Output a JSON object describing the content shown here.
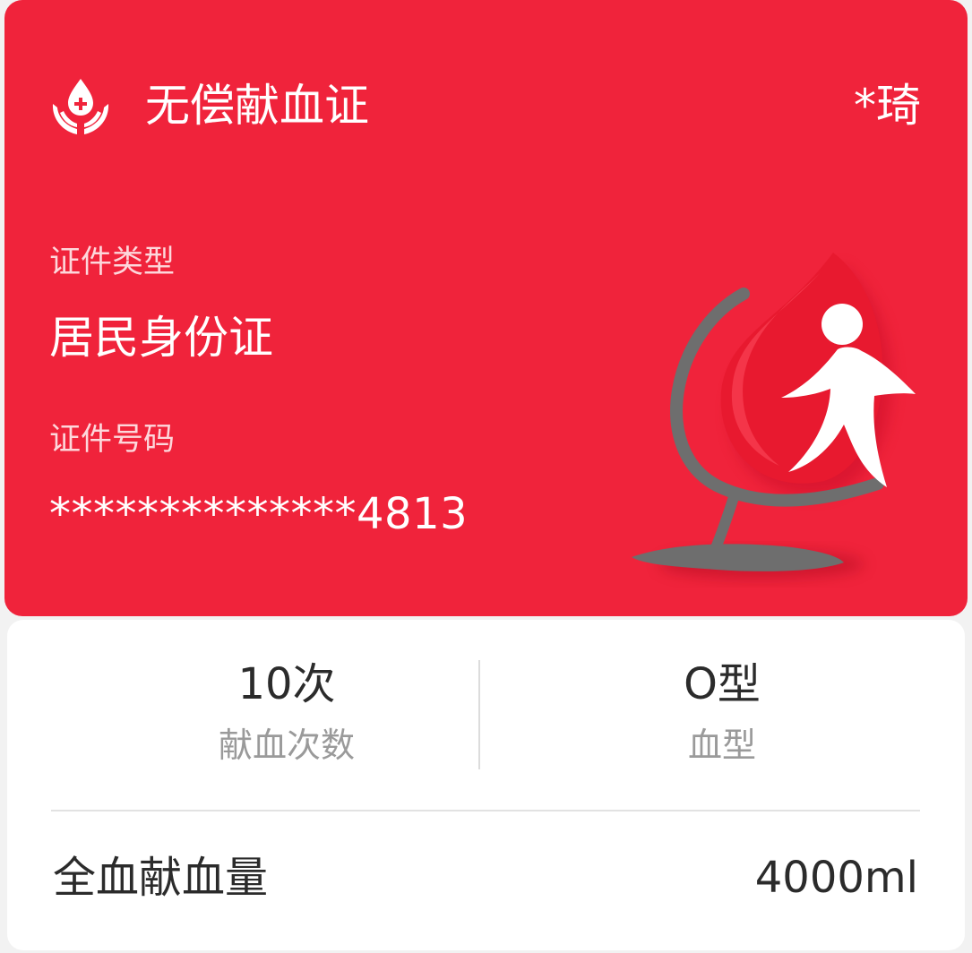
{
  "card": {
    "title": "无偿献血证",
    "holder_name": "*琦",
    "id_type_label": "证件类型",
    "id_type_value": "居民身份证",
    "id_number_label": "证件号码",
    "id_number_value": "**************4813",
    "icons": {
      "logo": "blood-drop-hands-icon",
      "emblem": "blood-drop-person-emblem"
    },
    "colors": {
      "card_background": "#f0233b",
      "text": "#ffffff"
    }
  },
  "stats": {
    "donation_count_value": "10次",
    "donation_count_label": "献血次数",
    "blood_type_value": "O型",
    "blood_type_label": "血型"
  },
  "volume": {
    "label": "全血献血量",
    "value": "4000ml"
  }
}
